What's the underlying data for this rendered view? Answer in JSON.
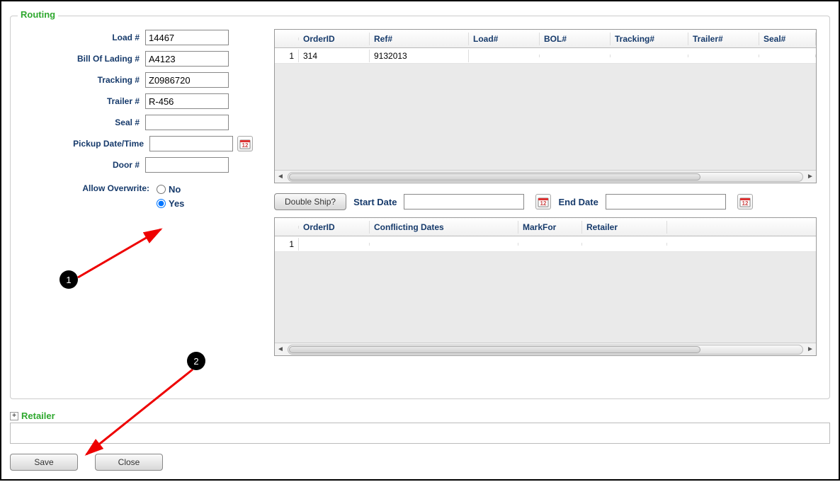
{
  "section": {
    "title": "Routing",
    "retailer_title": "Retailer"
  },
  "form": {
    "load_label": "Load #",
    "load_value": "14467",
    "bol_label": "Bill Of Lading #",
    "bol_value": "A4123",
    "tracking_label": "Tracking #",
    "tracking_value": "Z0986720",
    "trailer_label": "Trailer #",
    "trailer_value": "R-456",
    "seal_label": "Seal #",
    "seal_value": "",
    "pickup_label": "Pickup Date/Time",
    "pickup_value": "",
    "door_label": "Door #",
    "door_value": ""
  },
  "overwrite": {
    "label": "Allow Overwrite:",
    "no": "No",
    "yes": "Yes",
    "selected": "yes"
  },
  "grid1": {
    "headers": [
      "OrderID",
      "Ref#",
      "Load#",
      "BOL#",
      "Tracking#",
      "Trailer#",
      "Seal#"
    ],
    "rows": [
      {
        "rownum": "1",
        "OrderID": "314",
        "Ref": "9132013",
        "Load": "",
        "BOL": "",
        "Tracking": "",
        "Trailer": "",
        "Seal": ""
      }
    ]
  },
  "double": {
    "button": "Double Ship?",
    "start_label": "Start Date",
    "start_value": "",
    "end_label": "End Date",
    "end_value": ""
  },
  "grid2": {
    "headers": [
      "OrderID",
      "Conflicting Dates",
      "MarkFor",
      "Retailer"
    ],
    "rows": [
      {
        "rownum": "1",
        "OrderID": "",
        "Conflicting": "",
        "MarkFor": "",
        "Retailer": ""
      }
    ]
  },
  "buttons": {
    "save": "Save",
    "close": "Close"
  },
  "annotations": {
    "a1": "1",
    "a2": "2"
  }
}
